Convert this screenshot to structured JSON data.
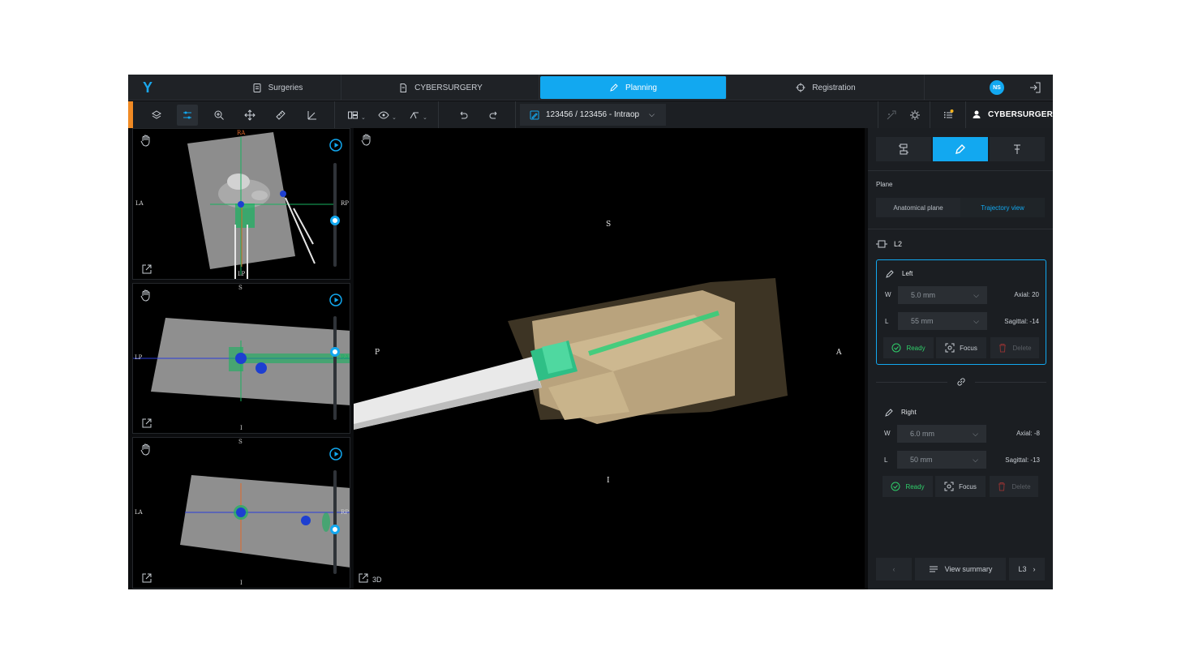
{
  "nav": {
    "logo": "Y",
    "tabs": [
      {
        "label": "Surgeries",
        "icon": "clipboard-icon"
      },
      {
        "label": "CYBERSURGERY",
        "icon": "document-icon"
      },
      {
        "label": "Planning",
        "icon": "pencil-icon"
      },
      {
        "label": "Registration",
        "icon": "crosshair-icon"
      }
    ],
    "active_tab": "Planning",
    "avatar_initials": "NS"
  },
  "toolbar": {
    "patient_label": "123456 / 123456 - Intraop",
    "user_label": "CYBERSURGERY",
    "accent_color": "#f08a24"
  },
  "viewports": {
    "axial": {
      "top": "RA",
      "left": "LA",
      "right": "RP",
      "bottom": "LP"
    },
    "sagittal": {
      "top": "S",
      "left": "LP",
      "right": "RA",
      "bottom": "I"
    },
    "coronal": {
      "top": "S",
      "left": "LA",
      "right": "RP",
      "bottom": "I"
    },
    "main3d": {
      "top": "S",
      "left": "P",
      "right": "A",
      "bottom": "I",
      "mode_label": "3D"
    }
  },
  "panel": {
    "plane_label": "Plane",
    "plane_options": [
      "Anatomical plane",
      "Trajectory view"
    ],
    "plane_selected": "Trajectory view",
    "level": "L2",
    "screws": [
      {
        "side": "Left",
        "w_label": "W",
        "w_value": "5.0 mm",
        "l_label": "L",
        "l_value": "55 mm",
        "axial": "Axial: 20",
        "sagittal": "Sagittal: -14",
        "ready": "Ready",
        "focus": "Focus",
        "delete": "Delete",
        "selected": true
      },
      {
        "side": "Right",
        "w_label": "W",
        "w_value": "6.0 mm",
        "l_label": "L",
        "l_value": "50 mm",
        "axial": "Axial: -8",
        "sagittal": "Sagittal: -13",
        "ready": "Ready",
        "focus": "Focus",
        "delete": "Delete",
        "selected": false
      }
    ],
    "view_summary": "View summary",
    "next_level": "L3"
  }
}
